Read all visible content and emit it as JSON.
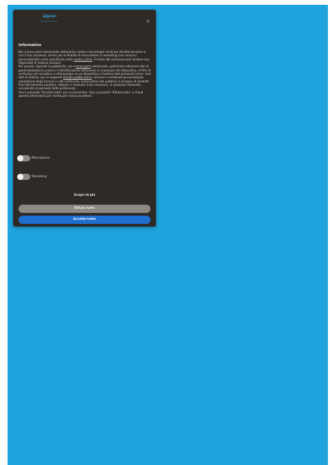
{
  "brand": {
    "logo_text": "jaguar",
    "logo_subtext": "Reveal the full story"
  },
  "dialog": {
    "close_glyph": "×",
    "title": "Informativa",
    "paragraph_1": {
      "before_link": "Noi e terze parti selezionate utilizziamo cookie o tecnologie simili per finalità tecniche e, con il tuo consenso, anche per le finalità di misurazione e marketing (con annunci personalizzati) come specificato nella ",
      "link": "cookie policy",
      "after_link": ". Il rifiuto del consenso può rendere non disponibili le relative funzioni."
    },
    "paragraph_2": {
      "before_link": "Per quanto riguarda la pubblicità, noi e ",
      "link": "terze parti",
      "after_link_1": " selezionate, potremmo utilizzare dati di geolocalizzazione precisi e l'identificazione attraverso la scansione del dispositivo, al fine di archiviare e/o accedere a informazioni su un dispositivo e trattare dati personali come i tuoi dati di utilizzo, per le seguenti ",
      "link_2": "finalità pubblicitarie",
      "after_link_2": ": annunci e contenuti personalizzati, valutazione degli annunci e del contenuto, osservazioni del pubblico e sviluppo di prodotti."
    },
    "paragraph_3": "Puoi liberamente prestare, rifiutare o revocare il tuo consenso, in qualsiasi momento, accedendo al pannello delle preferenze.",
    "paragraph_4": "Usa il pulsante \"Accetta tutto\" per acconsentire. Usa il pulsante \"Rifiuta tutto\" o chiudi questa informativa per continuare senza accettare.",
    "toggles": [
      {
        "label": "Misurazione",
        "on": false
      },
      {
        "label": "Marketing",
        "on": false
      }
    ],
    "buttons": {
      "learn_more": "Scopri di più",
      "reject_all": "Rifiuta tutto",
      "accept_all": "Accetta tutto"
    }
  },
  "colors": {
    "page_background": "#1fa4de",
    "dialog_background": "#2e2a26",
    "accept_button": "#1f6fd0",
    "reject_button": "#8d8884"
  }
}
